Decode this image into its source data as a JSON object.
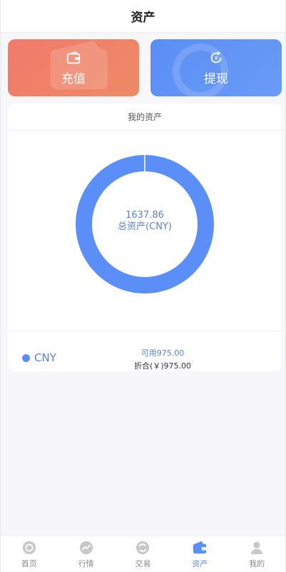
{
  "header": {
    "title": "资产"
  },
  "actions": {
    "recharge": {
      "label": "充值",
      "icon": "wallet-icon"
    },
    "withdraw": {
      "label": "提现",
      "icon": "yen-refresh-icon"
    }
  },
  "assets": {
    "title": "我的资产",
    "total_value": "1637.86",
    "total_label": "总资产(CNY)",
    "ring_color": "#5b8ef6",
    "legend": {
      "name": "CNY",
      "available": "可用975.00",
      "converted": "折合(￥)975.00"
    }
  },
  "chart_data": {
    "type": "pie",
    "categories": [
      "CNY"
    ],
    "values": [
      1637.86
    ],
    "title": "",
    "colors": [
      "#5b8ef6"
    ]
  },
  "tabbar": {
    "active": 3,
    "items": [
      {
        "label": "首页",
        "icon": "home-icon"
      },
      {
        "label": "行情",
        "icon": "trend-icon"
      },
      {
        "label": "交易",
        "icon": "exchange-icon"
      },
      {
        "label": "资产",
        "icon": "wallet-icon"
      },
      {
        "label": "我的",
        "icon": "user-icon"
      }
    ]
  }
}
